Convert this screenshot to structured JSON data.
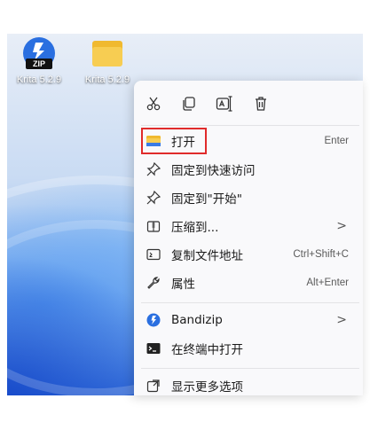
{
  "desktop": {
    "icons": [
      {
        "label": "Krita 5.2.9",
        "badge": "ZIP",
        "icon": "bandizip-zip-icon"
      },
      {
        "label": "Krita 5.2.9",
        "icon": "folder-icon"
      }
    ]
  },
  "context_menu": {
    "toolbar": [
      {
        "name": "cut",
        "icon": "scissors-icon"
      },
      {
        "name": "copy",
        "icon": "copy-icon"
      },
      {
        "name": "rename",
        "icon": "rename-icon"
      },
      {
        "name": "delete",
        "icon": "trash-icon"
      }
    ],
    "items": [
      {
        "label": "打开",
        "shortcut": "Enter",
        "icon": "folder-icon"
      },
      {
        "label": "固定到快速访问",
        "icon": "pin-icon"
      },
      {
        "label": "固定到\"开始\"",
        "icon": "pin-icon"
      },
      {
        "label": "压缩到...",
        "submenu": ">",
        "icon": "compress-icon"
      },
      {
        "label": "复制文件地址",
        "shortcut": "Ctrl+Shift+C",
        "icon": "path-icon"
      },
      {
        "label": "属性",
        "shortcut": "Alt+Enter",
        "icon": "wrench-icon"
      },
      {
        "label": "Bandizip",
        "submenu": ">",
        "icon": "bandizip-icon"
      },
      {
        "label": "在终端中打开",
        "icon": "terminal-icon"
      },
      {
        "label": "显示更多选项",
        "icon": "more-options-icon"
      }
    ],
    "colors": {
      "highlight_border": "#e02b2b",
      "accent": "#2a6fe0"
    }
  }
}
